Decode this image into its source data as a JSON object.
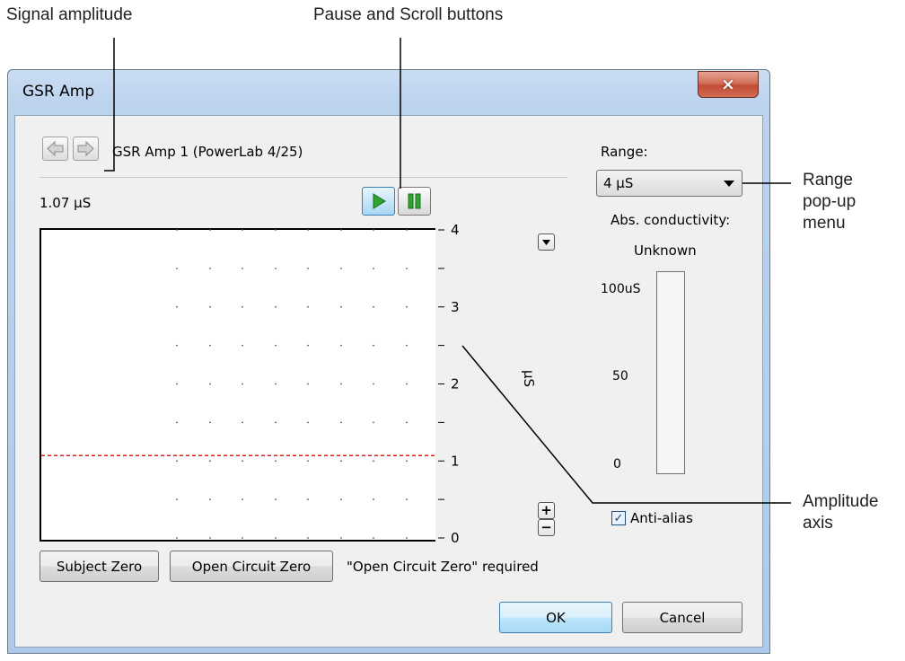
{
  "callouts": {
    "signal_amplitude": "Signal amplitude",
    "pause_scroll": "Pause and Scroll buttons",
    "range_popup": "Range\npop-up\nmenu",
    "amplitude_axis": "Amplitude\naxis"
  },
  "window": {
    "title": "GSR Amp",
    "close_icon": "×"
  },
  "header": {
    "device_label": "GSR Amp 1 (PowerLab 4/25)",
    "prev_icon": "arrow-left-icon",
    "next_icon": "arrow-right-icon"
  },
  "signal": {
    "amplitude": "1.07 µS"
  },
  "chart_data": {
    "type": "line",
    "ylim": [
      0,
      4
    ],
    "ylabel": "µS",
    "y_ticks": [
      "0",
      "1",
      "2",
      "3",
      "4"
    ],
    "series": [
      {
        "x": [
          0,
          1
        ],
        "y": [
          1.07,
          1.07
        ],
        "color": "#e02020"
      }
    ],
    "grid": "dotted"
  },
  "controls": {
    "plus_icon": "+",
    "minus_icon": "−",
    "subject_zero_label": "Subject Zero",
    "open_circuit_zero_label": "Open Circuit Zero",
    "required_text": "\"Open Circuit Zero\" required",
    "ok_label": "OK",
    "cancel_label": "Cancel"
  },
  "range": {
    "label": "Range:",
    "selected": "4 µS"
  },
  "conductivity": {
    "label": "Abs. conductivity:",
    "value": "Unknown",
    "scale_top": "100uS",
    "scale_mid": "50",
    "scale_bottom": "0",
    "fill_fraction": 0
  },
  "options": {
    "anti_alias_label": "Anti-alias",
    "anti_alias_checked": true,
    "check_glyph": "✓"
  }
}
